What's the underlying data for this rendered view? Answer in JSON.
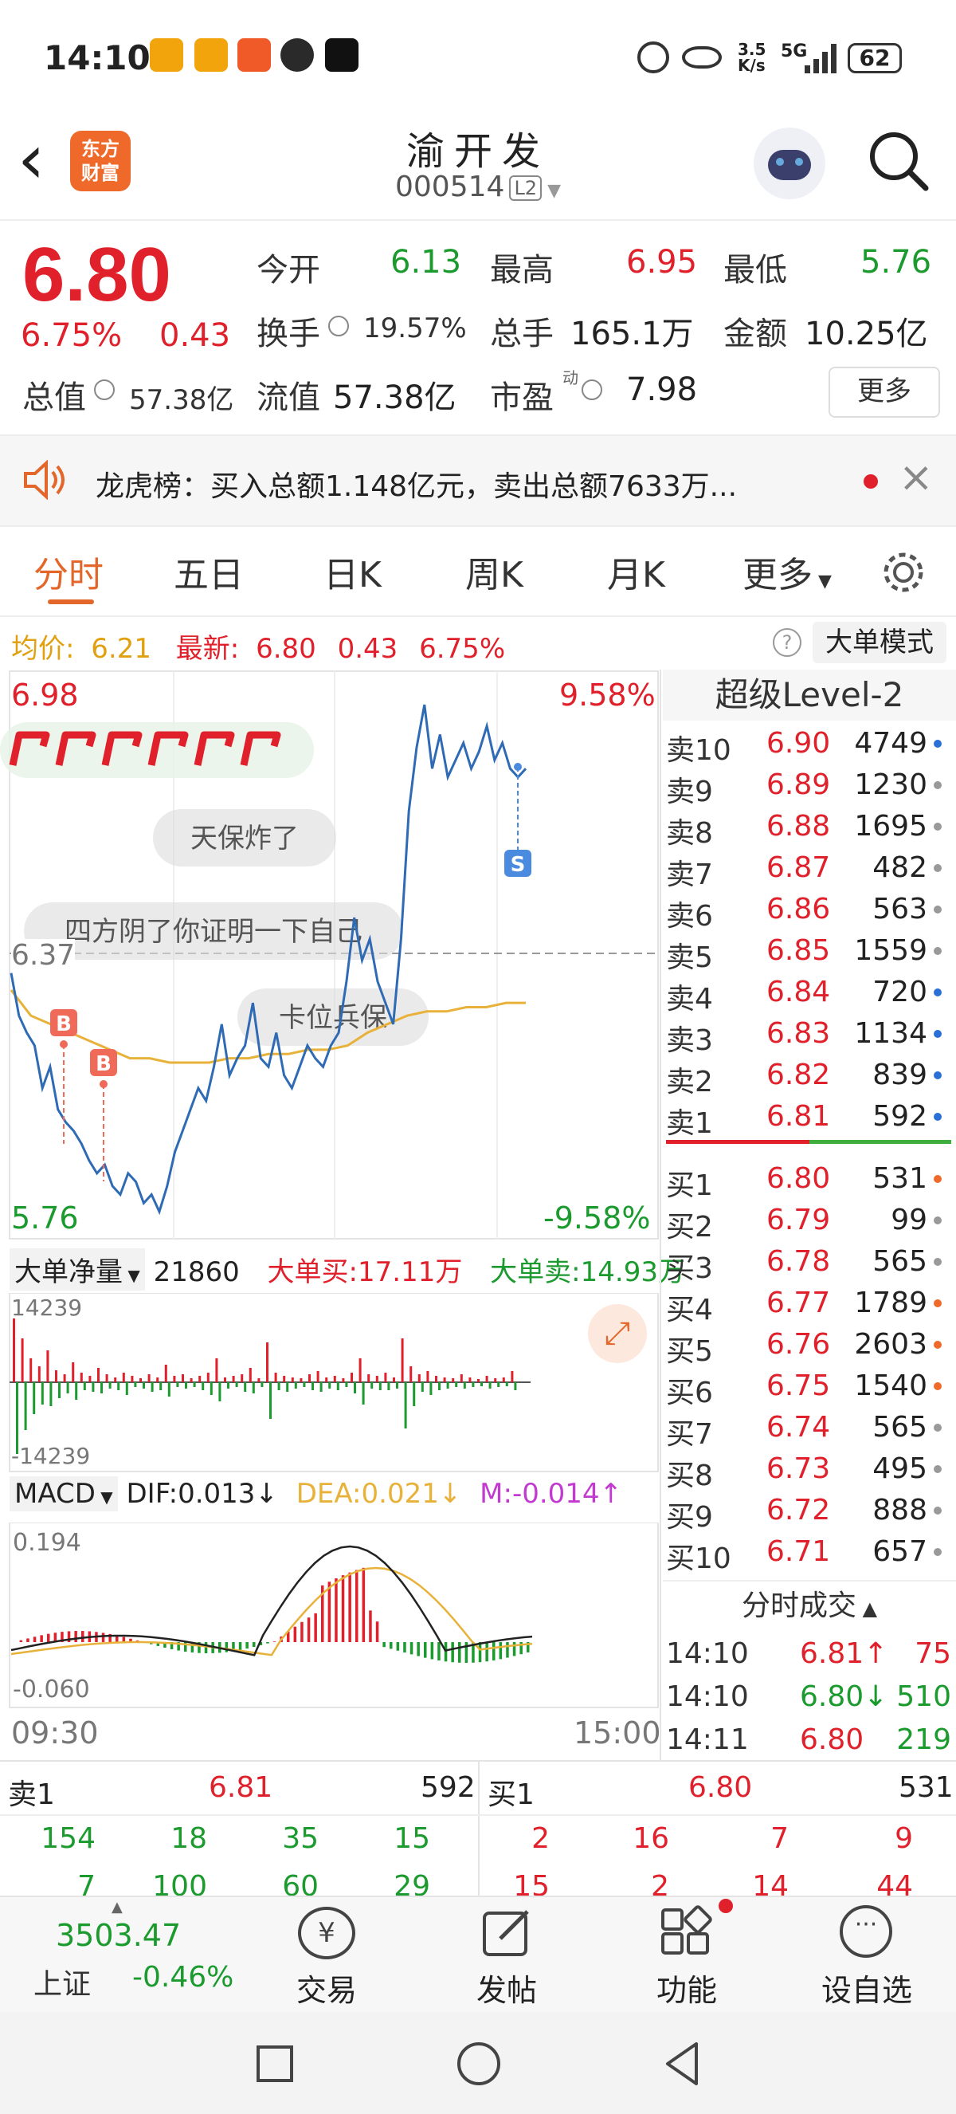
{
  "status_bar": {
    "time": "14:10",
    "net_speed_top": "3.5",
    "net_speed_bottom": "K/s",
    "network": "5G",
    "battery": "62"
  },
  "header": {
    "back_label": "‹",
    "logo_line1": "东方",
    "logo_line2": "财富",
    "title": "渝开发",
    "code": "000514",
    "level": "L2"
  },
  "quote": {
    "price": "6.80",
    "change_pct": "6.75%",
    "change": "0.43",
    "open_label": "今开",
    "open": "6.13",
    "high_label": "最高",
    "high": "6.95",
    "low_label": "最低",
    "low": "5.76",
    "turnover_label": "换手",
    "turnover": "19.57%",
    "volume_label": "总手",
    "volume": "165.1万",
    "amount_label": "金额",
    "amount": "10.25亿",
    "mktcap_label": "总值",
    "mktcap": "57.38亿",
    "float_label": "流值",
    "float": "57.38亿",
    "pe_label": "市盈",
    "pe_sup": "动",
    "pe": "7.98",
    "more_label": "更多"
  },
  "notice": {
    "text": "龙虎榜：买入总额1.148亿元，卖出总额7633万..."
  },
  "tabs": [
    "分时",
    "五日",
    "日K",
    "周K",
    "月K",
    "更多"
  ],
  "chart_header": {
    "avg_label": "均价:",
    "avg": "6.21",
    "latest_label": "最新:",
    "latest": "6.80",
    "chg": "0.43",
    "chg_pct": "6.75%",
    "mode_label": "大单模式"
  },
  "chart_data": {
    "type": "line",
    "y_top_left": "6.98",
    "y_top_right": "9.58%",
    "y_mid": "6.37",
    "y_bottom_left": "5.76",
    "y_bottom_right": "-9.58%",
    "ylim": [
      5.76,
      6.98
    ],
    "x_start": "09:30",
    "x_end": "15:00",
    "series": [
      {
        "values": [
          6.32,
          6.22,
          6.18,
          6.15,
          6.05,
          6.1,
          6.0,
          5.97,
          5.95,
          5.92,
          5.88,
          5.85,
          5.87,
          5.82,
          5.8,
          5.85,
          5.83,
          5.78,
          5.8,
          5.76,
          5.82,
          5.9,
          5.95,
          6.0,
          6.05,
          6.02,
          6.1,
          6.2,
          6.08,
          6.12,
          6.15,
          6.25,
          6.12,
          6.1,
          6.18,
          6.08,
          6.05,
          6.1,
          6.15,
          6.12,
          6.1,
          6.15,
          6.18,
          6.3,
          6.45,
          6.35,
          6.4,
          6.3,
          6.25,
          6.2,
          6.4,
          6.7,
          6.85,
          6.95,
          6.8,
          6.88,
          6.78,
          6.82,
          6.86,
          6.8,
          6.84,
          6.9,
          6.82,
          6.86,
          6.8,
          6.78,
          6.8
        ]
      },
      {
        "values": [
          6.28,
          6.22,
          6.2,
          6.18,
          6.16,
          6.14,
          6.12,
          6.12,
          6.11,
          6.11,
          6.11,
          6.12,
          6.12,
          6.13,
          6.13,
          6.14,
          6.14,
          6.15,
          6.18,
          6.2,
          6.22,
          6.23,
          6.23,
          6.24,
          6.24,
          6.25,
          6.25
        ]
      }
    ],
    "annotations": [
      "天保炸了",
      "四方阴了你证明一下自己",
      "卡位兵保"
    ],
    "markers": [
      "B",
      "B",
      "S"
    ]
  },
  "big_order": {
    "label": "大单净量",
    "value": "21860",
    "buy_label": "大单买:",
    "buy": "17.11万",
    "sell_label": "大单卖:",
    "sell": "14.93万",
    "top": "14239",
    "bottom": "-14239"
  },
  "macd": {
    "label": "MACD",
    "dif": "DIF:0.013",
    "dea": "DEA:0.021",
    "m": "M:-0.014",
    "top": "0.194",
    "bottom": "-0.060"
  },
  "orderbook": {
    "title": "超级Level-2",
    "asks": [
      {
        "label": "卖10",
        "price": "6.90",
        "vol": "4749",
        "dot": "#2a6fd6"
      },
      {
        "label": "卖9",
        "price": "6.89",
        "vol": "1230",
        "dot": "#999"
      },
      {
        "label": "卖8",
        "price": "6.88",
        "vol": "1695",
        "dot": "#999"
      },
      {
        "label": "卖7",
        "price": "6.87",
        "vol": "482",
        "dot": "#999"
      },
      {
        "label": "卖6",
        "price": "6.86",
        "vol": "563",
        "dot": "#999"
      },
      {
        "label": "卖5",
        "price": "6.85",
        "vol": "1559",
        "dot": "#999"
      },
      {
        "label": "卖4",
        "price": "6.84",
        "vol": "720",
        "dot": "#2a6fd6"
      },
      {
        "label": "卖3",
        "price": "6.83",
        "vol": "1134",
        "dot": "#2a6fd6"
      },
      {
        "label": "卖2",
        "price": "6.82",
        "vol": "839",
        "dot": "#2a6fd6"
      },
      {
        "label": "卖1",
        "price": "6.81",
        "vol": "592",
        "dot": "#2a6fd6"
      }
    ],
    "bids": [
      {
        "label": "买1",
        "price": "6.80",
        "vol": "531",
        "dot": "#ef6a2a"
      },
      {
        "label": "买2",
        "price": "6.79",
        "vol": "99",
        "dot": "#999"
      },
      {
        "label": "买3",
        "price": "6.78",
        "vol": "565",
        "dot": "#999"
      },
      {
        "label": "买4",
        "price": "6.77",
        "vol": "1789",
        "dot": "#ef6a2a"
      },
      {
        "label": "买5",
        "price": "6.76",
        "vol": "2603",
        "dot": "#ef6a2a"
      },
      {
        "label": "买6",
        "price": "6.75",
        "vol": "1540",
        "dot": "#ef6a2a"
      },
      {
        "label": "买7",
        "price": "6.74",
        "vol": "565",
        "dot": "#999"
      },
      {
        "label": "买8",
        "price": "6.73",
        "vol": "495",
        "dot": "#999"
      },
      {
        "label": "买9",
        "price": "6.72",
        "vol": "888",
        "dot": "#999"
      },
      {
        "label": "买10",
        "price": "6.71",
        "vol": "657",
        "dot": "#999"
      }
    ]
  },
  "ticks": {
    "title": "分时成交",
    "rows": [
      {
        "time": "14:10",
        "price": "6.81↑",
        "vol": "75"
      },
      {
        "time": "14:10",
        "price": "6.80↓",
        "vol": "510"
      },
      {
        "time": "14:11",
        "price": "6.80",
        "vol": "219"
      }
    ]
  },
  "queue": {
    "ask_label": "卖1",
    "ask_price": "6.81",
    "ask_vol": "592",
    "bid_label": "买1",
    "bid_price": "6.80",
    "bid_vol": "531",
    "ask_row1": [
      "154",
      "18",
      "35",
      "15"
    ],
    "ask_row2": [
      "7",
      "100",
      "60",
      "29"
    ],
    "bid_row1": [
      "2",
      "16",
      "7",
      "9"
    ],
    "bid_row2": [
      "15",
      "2",
      "14",
      "44"
    ]
  },
  "bottom_bar": {
    "index_value": "3503.47",
    "index_name": "上证",
    "index_chg": "-0.46%",
    "trade": "交易",
    "post": "发帖",
    "func": "功能",
    "watch": "设自选"
  }
}
